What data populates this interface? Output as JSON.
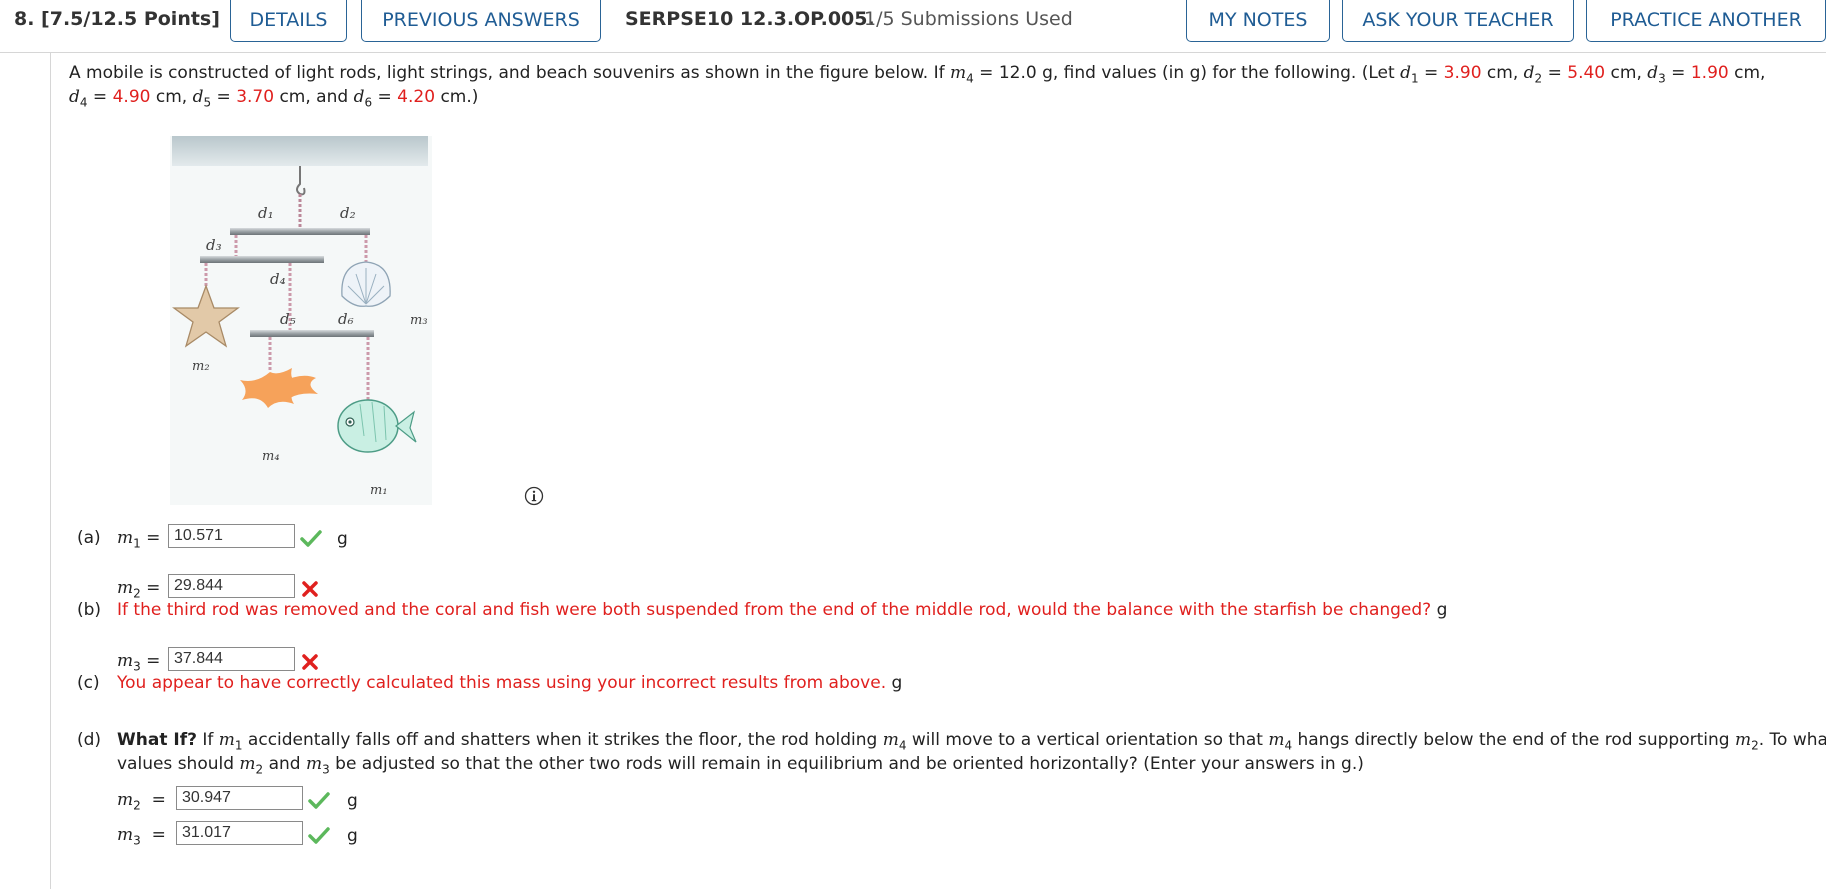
{
  "header": {
    "question_label": "8. [7.5/12.5 Points]",
    "details": "DETAILS",
    "previous_answers": "PREVIOUS ANSWERS",
    "code": "SERPSE10 12.3.OP.005.",
    "submissions": "1/5 Submissions Used",
    "my_notes": "MY NOTES",
    "ask_teacher": "ASK YOUR TEACHER",
    "practice_another": "PRACTICE ANOTHER"
  },
  "problem": {
    "intro": "A mobile is constructed of light rods, light strings, and beach souvenirs as shown in the figure below. If ",
    "m4_eq": " = 12.0 g, find values (in g) for the following. (Let ",
    "d1_val": "3.90",
    "d2_val": "5.40",
    "d3_val": "1.90",
    "d4_val": "4.90",
    "d5_val": "3.70",
    "d6_val": "4.20",
    "unit_cm": "cm"
  },
  "figure_labels": {
    "d1": "d₁",
    "d2": "d₂",
    "d3": "d₃",
    "d4": "d₄",
    "d5": "d₅",
    "d6": "d₆",
    "m1": "m₁",
    "m2": "m₂",
    "m3": "m₃",
    "m4": "m₄"
  },
  "part_a": {
    "label": "(a)",
    "var": "m",
    "sub": "1",
    "value": "10.571",
    "unit": "g"
  },
  "part_b": {
    "label": "(b)",
    "var": "m",
    "sub": "2",
    "value": "29.844",
    "feedback": "If the third rod was removed and the coral and fish were both suspended from the end of the middle rod, would the balance with the starfish be changed?",
    "unit": "g"
  },
  "part_c": {
    "label": "(c)",
    "var": "m",
    "sub": "3",
    "value": "37.844",
    "feedback": "You appear to have correctly calculated this mass using your incorrect results from above.",
    "unit": "g"
  },
  "part_d": {
    "label": "(d)",
    "what_if": "What If?",
    "t1": " If ",
    "t2": " accidentally falls off and shatters when it strikes the floor, the rod holding ",
    "t3": " will move to a vertical orientation so that ",
    "t4": " hangs directly below the end of the rod supporting ",
    "t5": ". To what",
    "t6": "values should ",
    "t7": " and ",
    "t8": " be adjusted so that the other two rods will remain in equilibrium and be oriented horizontally? (Enter your answers in g.)",
    "m2_value": "30.947",
    "m3_value": "31.017",
    "unit": "g"
  },
  "colors": {
    "accent": "#1f5c94",
    "correct": "#5cb85c",
    "incorrect": "#e0201e"
  }
}
